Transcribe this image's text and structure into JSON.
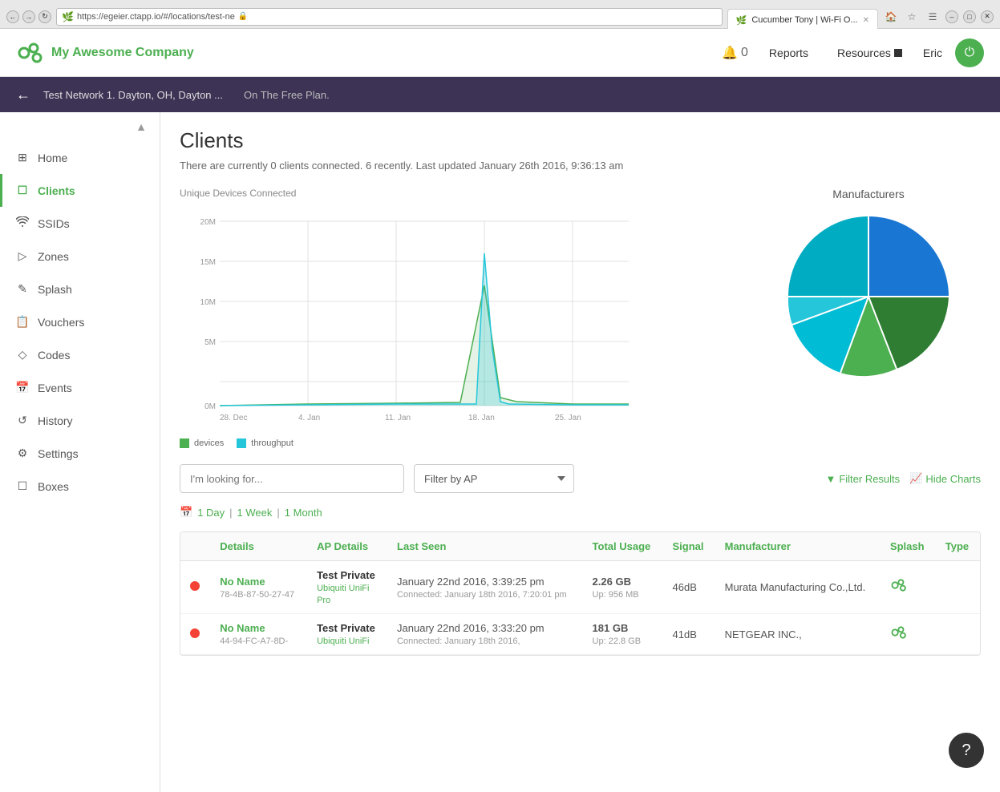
{
  "browser": {
    "url": "https://egeier.ctapp.io/#/locations/test-ne",
    "tab_label": "Cucumber Tony | Wi-Fi O...",
    "tab_favicon": "🌿"
  },
  "topnav": {
    "company_name": "My Awesome Company",
    "bell_count": "0",
    "reports_label": "Reports",
    "resources_label": "Resources",
    "user_name": "Eric",
    "user_avatar_symbol": "⏻"
  },
  "breadcrumb": {
    "back_arrow": "←",
    "network_name": "Test Network 1. Dayton, OH, Dayton ...",
    "plan_label": "On The Free Plan."
  },
  "sidebar": {
    "collapse_icon": "▲",
    "items": [
      {
        "id": "home",
        "label": "Home",
        "icon": "⊞"
      },
      {
        "id": "clients",
        "label": "Clients",
        "icon": "☐"
      },
      {
        "id": "ssids",
        "label": "SSIDs",
        "icon": "📶"
      },
      {
        "id": "zones",
        "label": "Zones",
        "icon": "▷"
      },
      {
        "id": "splash",
        "label": "Splash",
        "icon": "✎"
      },
      {
        "id": "vouchers",
        "label": "Vouchers",
        "icon": "📋"
      },
      {
        "id": "codes",
        "label": "Codes",
        "icon": "◇"
      },
      {
        "id": "events",
        "label": "Events",
        "icon": "📅"
      },
      {
        "id": "history",
        "label": "History",
        "icon": "↺"
      },
      {
        "id": "settings",
        "label": "Settings",
        "icon": "⚙"
      },
      {
        "id": "boxes",
        "label": "Boxes",
        "icon": "☐"
      }
    ]
  },
  "content": {
    "page_title": "Clients",
    "status_text": "There are currently 0 clients connected. 6 recently. Last updated January 26th 2016, 9:36:13 am",
    "chart": {
      "title": "Unique Devices Connected",
      "x_labels": [
        "28. Dec",
        "4. Jan",
        "11. Jan",
        "18. Jan",
        "25. Jan"
      ],
      "y_labels": [
        "20M",
        "15M",
        "10M",
        "5M",
        "0M"
      ],
      "legend": [
        {
          "id": "devices",
          "label": "devices",
          "color": "#4CAF50"
        },
        {
          "id": "throughput",
          "label": "throughput",
          "color": "#26C6DA"
        }
      ]
    },
    "manufacturers_chart": {
      "title": "Manufacturers"
    },
    "filters": {
      "search_placeholder": "I'm looking for...",
      "ap_filter_label": "Filter by AP",
      "filter_results_label": "Filter Results",
      "hide_charts_label": "Hide Charts",
      "time_filters": {
        "icon": "📅",
        "day": "1 Day",
        "week": "1 Week",
        "month": "1 Month"
      }
    },
    "table": {
      "columns": [
        "",
        "Details",
        "AP Details",
        "Last Seen",
        "Total Usage",
        "Signal",
        "Manufacturer",
        "Splash",
        "Type"
      ],
      "rows": [
        {
          "status": "offline",
          "name": "No Name",
          "mac": "78-4B-87-50-27-47",
          "ap_name": "Test Private",
          "ap_model": "Ubiquiti UniFi",
          "ap_variant": "Pro",
          "last_seen": "January 22nd 2016, 3:39:25 pm",
          "connected": "Connected: January 18th 2016, 7:20:01 pm",
          "total_usage": "2.26 GB",
          "usage_up": "Up: 956 MB",
          "signal": "46dB",
          "manufacturer": "Murata Manufacturing Co.,Ltd.",
          "splash": "🌿",
          "type": ""
        },
        {
          "status": "offline",
          "name": "No Name",
          "mac": "44-94-FC-A7-8D-",
          "ap_name": "Test Private",
          "ap_model": "Ubiquiti UniFi",
          "ap_variant": "",
          "last_seen": "January 22nd 2016, 3:33:20 pm",
          "connected": "Connected: January 18th 2016,",
          "total_usage": "181 GB",
          "usage_up": "Up: 22.8 GB",
          "signal": "41dB",
          "manufacturer": "NETGEAR INC.,",
          "splash": "🌿",
          "type": ""
        }
      ]
    }
  },
  "help_button_label": "?"
}
